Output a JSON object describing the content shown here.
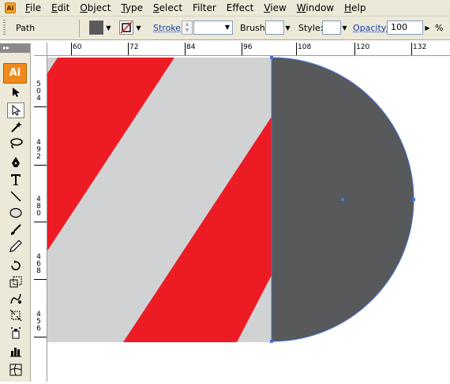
{
  "menubar": {
    "items": [
      {
        "underline": "F",
        "rest": "ile"
      },
      {
        "underline": "E",
        "rest": "dit"
      },
      {
        "underline": "O",
        "rest": "bject"
      },
      {
        "underline": "T",
        "rest": "ype"
      },
      {
        "underline": "S",
        "rest": "elect"
      },
      {
        "underline": "",
        "rest": "Filter"
      },
      {
        "underline": "",
        "rest": "Effect"
      },
      {
        "underline": "V",
        "rest": "iew"
      },
      {
        "underline": "W",
        "rest": "indow"
      },
      {
        "underline": "H",
        "rest": "elp"
      }
    ]
  },
  "controlbar": {
    "selection_label": "Path",
    "stroke_label": "Stroke:",
    "brush_label": "Brush:",
    "style_label": "Style:",
    "opacity_label": "Opacity:",
    "opacity_value": "100",
    "opacity_unit": "%",
    "fill_color": "#58595b"
  },
  "toolbox": {
    "logo": "Ai",
    "tools": [
      "selection-arrow-icon",
      "direct-selection-icon",
      "magic-wand-icon",
      "lasso-icon",
      "pen-icon",
      "type-icon",
      "line-segment-icon",
      "ellipse-icon",
      "paintbrush-icon",
      "pencil-icon",
      "rotate-icon",
      "scale-icon",
      "warp-icon",
      "free-transform-icon",
      "symbol-sprayer-icon",
      "column-graph-icon",
      "mesh-icon"
    ]
  },
  "rulers": {
    "horizontal": [
      "60",
      "72",
      "84",
      "96",
      "108",
      "120",
      "132"
    ],
    "vertical": [
      [
        "5",
        "0",
        "4"
      ],
      [
        "4",
        "9",
        "2"
      ],
      [
        "4",
        "8",
        "0"
      ],
      [
        "4",
        "6",
        "8"
      ],
      [
        "4",
        "5",
        "6"
      ]
    ]
  },
  "artwork": {
    "red": "#ed1c24",
    "gray": "#d1d2d3",
    "dark": "#58595b",
    "selection": "#4a72d8"
  }
}
